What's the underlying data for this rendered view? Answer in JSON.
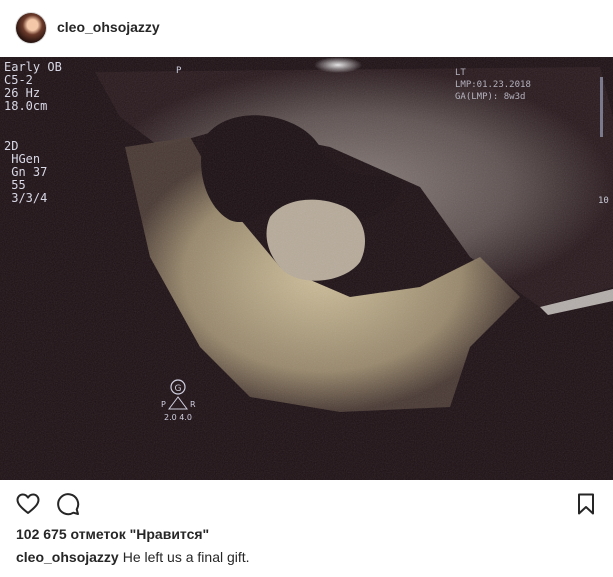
{
  "post": {
    "username": "cleo_ohsojazzy",
    "likes_text": "102 675 отметок \"Нравится\"",
    "caption": {
      "username": "cleo_ohsojazzy",
      "text": "He left us a final gift."
    }
  },
  "photo_overlay": {
    "left_lines": "Early OB\nC5-2\n26 Hz\n18.0cm",
    "left_lines2": "2D\n HGen\n Gn 37\n 55\n 3/3/4",
    "p_mark": "P",
    "right_lines": "LT\nLMP:01.23.2018\nGA(LMP): 8w3d",
    "right_edge": "10",
    "marker_letter": "G",
    "marker_p": "P",
    "marker_r": "R",
    "marker_values": "2.0 4.0"
  },
  "icons": {
    "like": "heart-icon",
    "comment": "comment-icon",
    "save": "bookmark-icon"
  },
  "colors": {
    "text": "#262626",
    "photo_bg": "#1d1014"
  }
}
